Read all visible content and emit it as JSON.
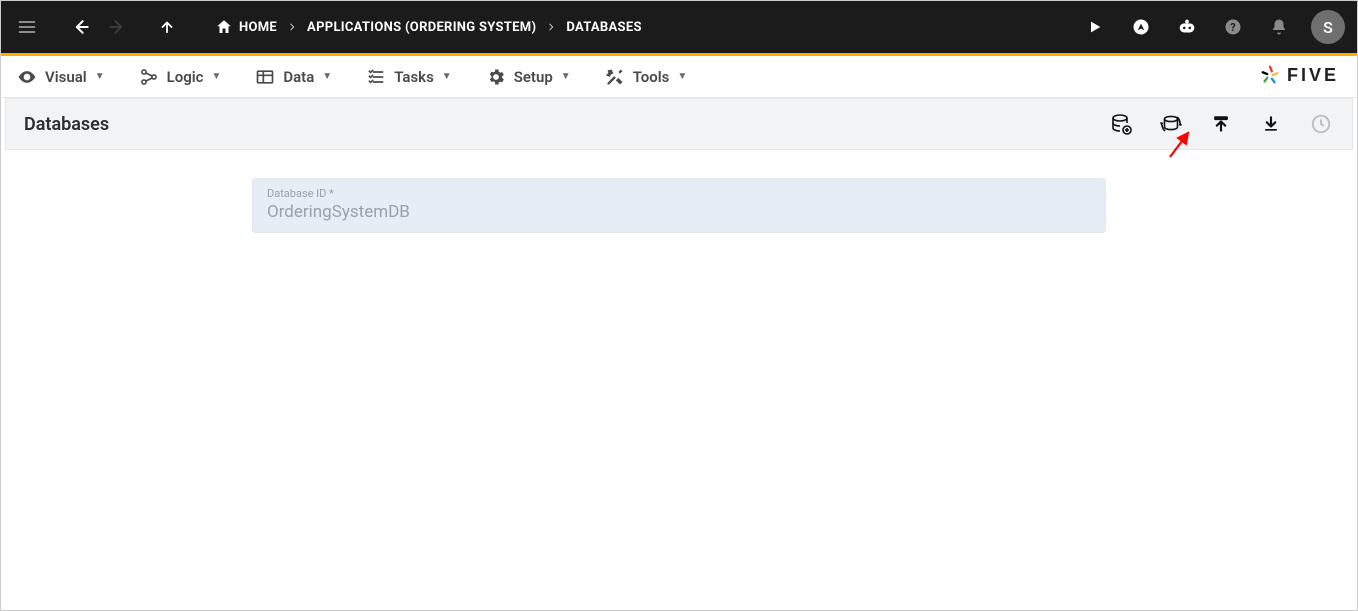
{
  "topbar": {
    "breadcrumbs": {
      "home": "HOME",
      "app": "APPLICATIONS (ORDERING SYSTEM)",
      "leaf": "DATABASES"
    },
    "avatar_initial": "S"
  },
  "menubar": {
    "visual": "Visual",
    "logic": "Logic",
    "data": "Data",
    "tasks": "Tasks",
    "setup": "Setup",
    "tools": "Tools",
    "brand": "FIVE"
  },
  "pagehead": {
    "title": "Databases"
  },
  "form": {
    "database_id_label": "Database ID *",
    "database_id_value": "OrderingSystemDB"
  }
}
